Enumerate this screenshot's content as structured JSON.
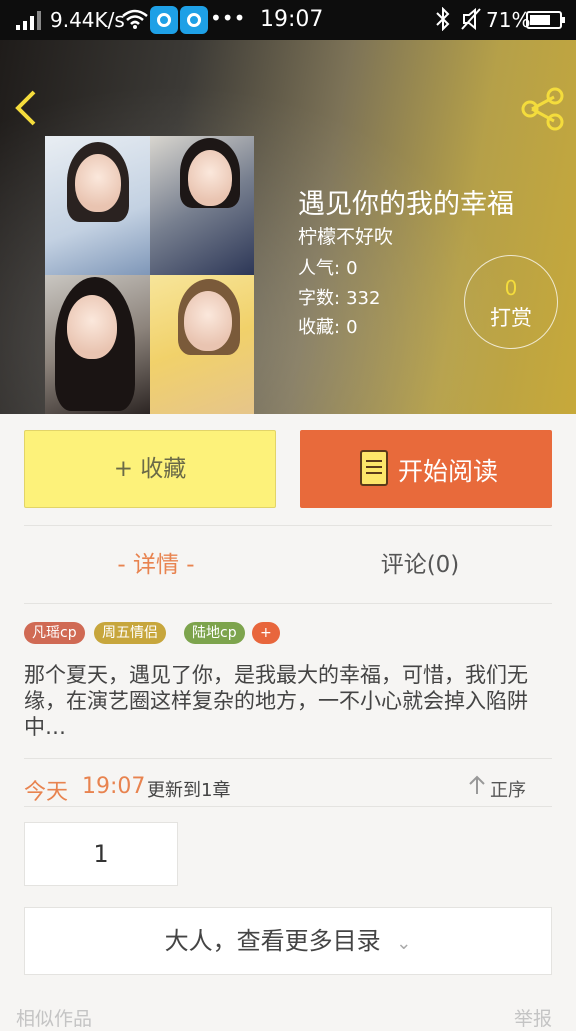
{
  "status_bar": {
    "speed": "9.44K/s",
    "more": "•••",
    "time": "19:07",
    "battery_text": "71%",
    "battery_level": 0.71
  },
  "book": {
    "title": "遇见你的我的幸福",
    "author": "柠檬不好吹",
    "stats": [
      {
        "label": "人气:",
        "value": "0"
      },
      {
        "label": "字数:",
        "value": "332"
      },
      {
        "label": "收藏:",
        "value": "0"
      }
    ],
    "reward_count": "0",
    "reward_label": "打赏"
  },
  "actions": {
    "favorite": "+ 收藏",
    "read": "开始阅读"
  },
  "tabs": {
    "detail": "- 详情 -",
    "comments": "评论(0)"
  },
  "tags": [
    {
      "label": "凡瑶cp",
      "color": "#d06a54"
    },
    {
      "label": "周五情侣",
      "color": "#c7a63c"
    },
    {
      "label": "陆地cp",
      "color": "#7da44d"
    },
    {
      "label": "+",
      "color": "#e8663c"
    }
  ],
  "description": "那个夏天，遇见了你，是我最大的幸福，可惜，我们无缘，在演艺圈这样复杂的地方，一不小心就会掉入陷阱中…",
  "update": {
    "day": "今天",
    "time": "19:07",
    "text": "更新到1章",
    "sort": "正序"
  },
  "chapter_number": "1",
  "more_catalog": "大人，查看更多目录",
  "footer": {
    "similar": "相似作品",
    "report": "举报"
  }
}
